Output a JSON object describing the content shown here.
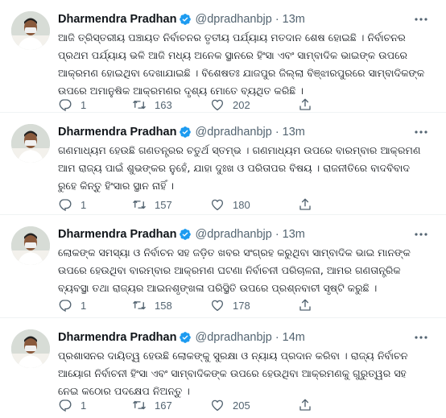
{
  "tweets": [
    {
      "name": "Dharmendra Pradhan",
      "handle": "@dpradhanbjp",
      "dot": "·",
      "time": "13m",
      "text": "ଆଜି ତ୍ରିସ୍ତରୀୟ ପଞ୍ଚାୟତ ନିର୍ବାଚନର ତୃତୀୟ ପର୍ଯ୍ୟାୟ ମତଦାନ ଶେଷ ହୋଇଛି । ନିର୍ବାଚନର ପ୍ରଥମ ପର୍ଯ୍ୟାୟ ଭଳି ଆଜି ମଧ୍ୟ ଅନେକ ସ୍ଥାନରେ ହିଂସା ଏବଂ ସାମ୍ବାଦିକ ଭାଇଙ୍କ ଉପରେ ଆକ୍ରମଣ ହୋଇଥିବା ଦେଖାଯାଇଛି । ବିଶେଷତଃ ଯାଜପୁର ଜିଲ୍ଲା ବିଞ୍ଝାରପୁରରେ ସାମ୍ବାଦିକଙ୍କ ଉପରେ ଅମାନୁଷିକ ଆକ୍ରମଣର ଦୃଶ୍ୟ ମୋତେ ବ୍ୟଥିତ କରିଛି ।",
      "replies": "1",
      "retweets": "163",
      "likes": "202"
    },
    {
      "name": "Dharmendra Pradhan",
      "handle": "@dpradhanbjp",
      "dot": "·",
      "time": "13m",
      "text": "ଗଣମାଧ୍ୟମ ହେଉଛି ଗଣତନ୍ତ୍ରର ଚତୁର୍ଥ ସ୍ତମ୍ଭ । ଗଣମାଧ୍ୟମ ଉପରେ ବାରମ୍ବାର ଆକ୍ରମଣ ଆମ ରାଜ୍ୟ ପାଇଁ ଶୁଭଙ୍କର ନୁହେଁ, ଯାହା ଦୁଃଖ ଓ ପରିତାପର ବିଷୟ । ରାଜନୀତିରେ ବାଦବିବାଦ ରୁହେ କିନ୍ତୁ ହିଂସାର ସ୍ଥାନ ନାହିଁ ।",
      "replies": "1",
      "retweets": "157",
      "likes": "180"
    },
    {
      "name": "Dharmendra Pradhan",
      "handle": "@dpradhanbjp",
      "dot": "·",
      "time": "13m",
      "text": "ଲୋକଙ୍କ ସମସ୍ୟା ଓ ନିର୍ବାଚନ ସହ ଜଡ଼ିତ ଖବର ସଂଗ୍ରହ କରୁଥିବା ସାମ୍ବାଦିକ ଭାଇ ମାନଙ୍କ ଉପରେ ହେଉଥିବା ବାରମ୍ବାର ଆକ୍ରମଣ ଘଟଣା ନିର୍ବାଚନୀ ପରିଚାଳନା, ଆମର ଗଣତାନ୍ତ୍ରିକ ବ୍ୟବସ୍ଥା ତଥା ରାଜ୍ୟର ଆଇନଶୃଙ୍ଖଳା ପରିସ୍ଥିତି ଉପରେ ପ୍ରଶ୍ନବାଚୀ ସୃଷ୍ଟି କରୁଛି ।",
      "replies": "1",
      "retweets": "158",
      "likes": "178"
    },
    {
      "name": "Dharmendra Pradhan",
      "handle": "@dpradhanbjp",
      "dot": "·",
      "time": "14m",
      "text": "ପ୍ରଶାସନର ଦାୟିତ୍ୱ ହେଉଛି ଲୋକଙ୍କୁ ସୁରକ୍ଷା ଓ ନ୍ୟାୟ ପ୍ରଦାନ କରିବା । ରାଜ୍ୟ ନିର୍ବାଚନ ଆୟୋଗ ନିର୍ବାଚନୀ ହିଂସା ଏବଂ ସାମ୍ବାଦିକଙ୍କ ଉପରେ ହେଉଥିବା ଆକ୍ରମଣକୁ ଗୁରୁତ୍ୱର ସହ ନେଇ କଠୋର ପଦକ୍ଷେପ ନିଅନ୍ତୁ ।",
      "replies": "1",
      "retweets": "167",
      "likes": "205"
    }
  ],
  "colors": {
    "text": "#0f1419",
    "secondary": "#536471",
    "verified": "#1d9bf0",
    "divider": "#eff3f4"
  },
  "icons": [
    "avatar",
    "verified-badge-icon",
    "more-options-icon",
    "reply-icon",
    "retweet-icon",
    "like-icon",
    "share-icon"
  ]
}
